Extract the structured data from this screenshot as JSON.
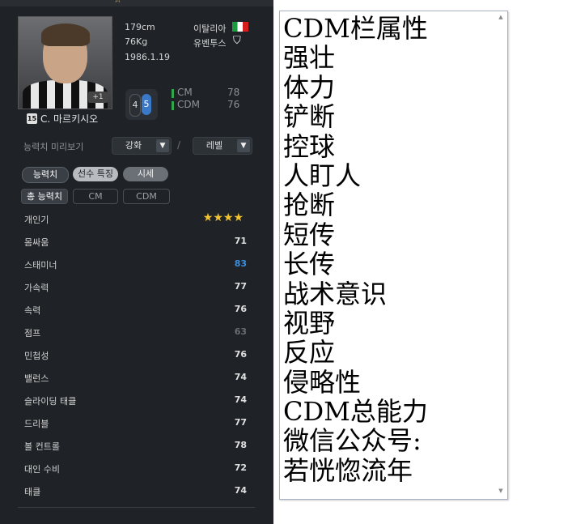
{
  "player": {
    "height": "179cm",
    "weight": "76Kg",
    "birth": "1986.1.19",
    "nationality": "이탈리아",
    "club": "유벤투스",
    "number": "15",
    "name": "C. 마르키시오",
    "plus_badge": "+1",
    "ovr_a": "4",
    "ovr_b": "5",
    "positions": [
      {
        "label": "CM",
        "value": "78"
      },
      {
        "label": "CDM",
        "value": "76"
      }
    ]
  },
  "controls": {
    "preview_label": "능력치 미리보기",
    "enhance": "강화",
    "level": "레벨",
    "slash": "/"
  },
  "tabs": [
    "능력치",
    "선수 특징",
    "시세"
  ],
  "subtabs": [
    "총 능력치",
    "CM",
    "CDM"
  ],
  "stats": [
    {
      "name": "개인기",
      "stars": "★★★★"
    },
    {
      "name": "몸싸움",
      "value": "71",
      "color": "#e0e0e0"
    },
    {
      "name": "스태미너",
      "value": "83",
      "color": "#3d8fe0"
    },
    {
      "name": "가속력",
      "value": "77",
      "color": "#e0e0e0"
    },
    {
      "name": "속력",
      "value": "76",
      "color": "#e0e0e0"
    },
    {
      "name": "점프",
      "value": "63",
      "color": "#6a6e73"
    },
    {
      "name": "민첩성",
      "value": "76",
      "color": "#e0e0e0"
    },
    {
      "name": "밸런스",
      "value": "74",
      "color": "#e0e0e0"
    },
    {
      "name": "슬라이딩 태클",
      "value": "74",
      "color": "#e0e0e0"
    },
    {
      "name": "드리블",
      "value": "77",
      "color": "#e0e0e0"
    },
    {
      "name": "볼 컨트롤",
      "value": "78",
      "color": "#e0e0e0"
    },
    {
      "name": "대인 수비",
      "value": "72",
      "color": "#e0e0e0"
    },
    {
      "name": "태클",
      "value": "74",
      "color": "#e0e0e0"
    }
  ],
  "textbox": {
    "lines": [
      "CDM栏属性",
      "强壮",
      "体力",
      "铲断",
      "控球",
      "人盯人",
      "抢断",
      "短传",
      "长传",
      "战术意识",
      "视野",
      "反应",
      "侵略性",
      "CDM总能力",
      "微信公众号:",
      "若恍惚流年"
    ]
  },
  "icons": {
    "club": "juventus-crest-icon",
    "flag": "italy-flag-icon",
    "dropdown_arrow": "▼",
    "scroll_up": "▲",
    "scroll_down": "▼"
  }
}
